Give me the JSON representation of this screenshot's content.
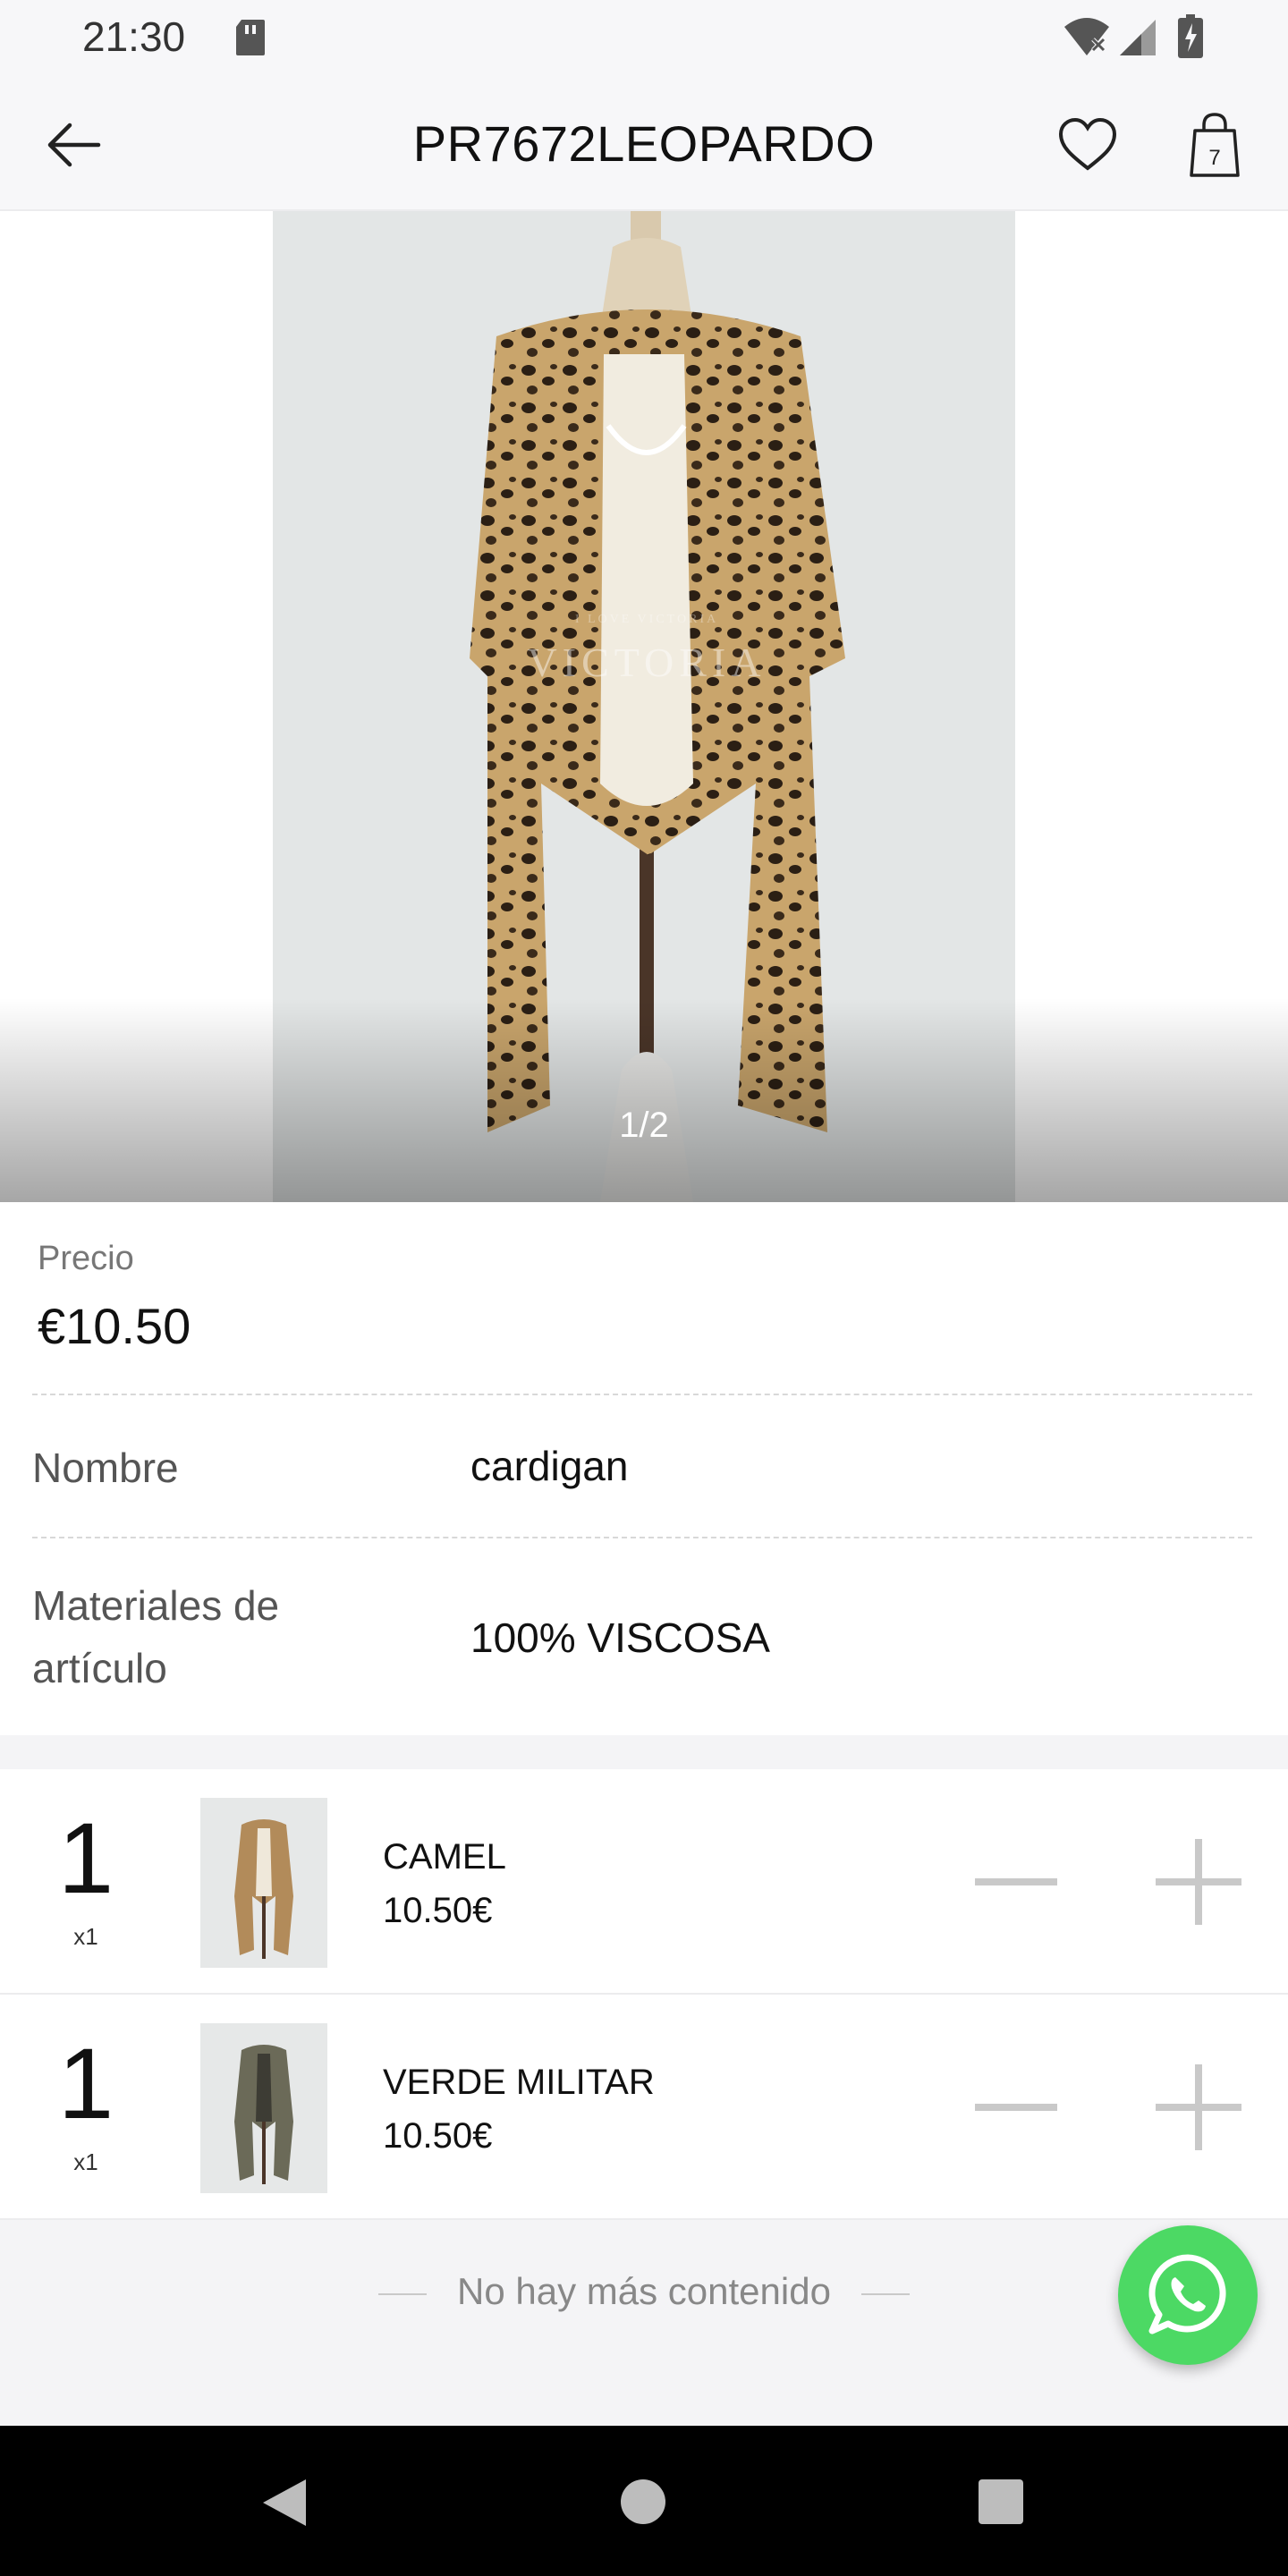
{
  "status_bar": {
    "time": "21:30"
  },
  "header": {
    "title": "PR7672LEOPARDO",
    "cart_count": "7"
  },
  "gallery": {
    "counter": "1/2",
    "watermark_small": "I LOVE VICTORIA",
    "watermark": "VICTORIA"
  },
  "details": {
    "price_label": "Precio",
    "price_value": "€10.50",
    "name_label": "Nombre",
    "name_value": "cardigan",
    "material_label_line1": "Materiales de",
    "material_label_line2": "artículo",
    "material_value": "100% VISCOSA"
  },
  "variants": [
    {
      "qty": "1",
      "multiplier": "x1",
      "name": "CAMEL",
      "price": "10.50€"
    },
    {
      "qty": "1",
      "multiplier": "x1",
      "name": "VERDE MILITAR",
      "price": "10.50€"
    }
  ],
  "footer": {
    "end_text": "No hay más contenido"
  },
  "colors": {
    "whatsapp": "#4cd964",
    "control_gray": "#c9c9c9",
    "header_bg": "#f7f7f9"
  },
  "icons": [
    "back-arrow-icon",
    "heart-icon",
    "shopping-bag-icon",
    "minus-icon",
    "plus-icon",
    "whatsapp-icon"
  ]
}
